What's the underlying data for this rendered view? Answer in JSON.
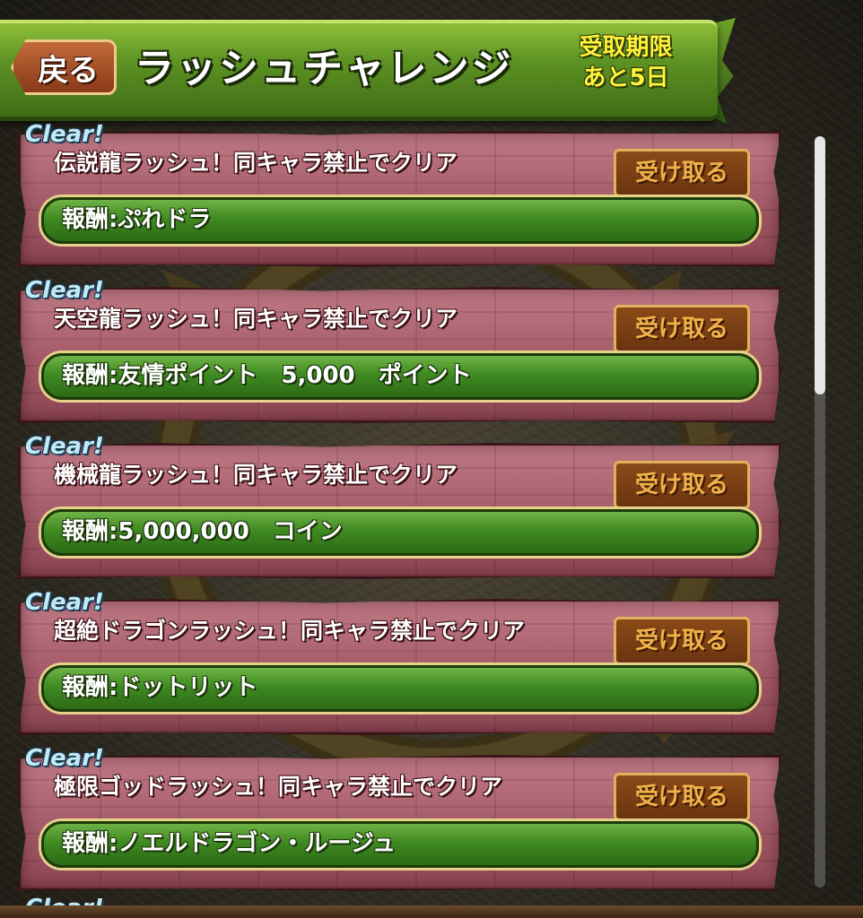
{
  "header": {
    "back_label": "戻る",
    "title": "ラッシュチャレンジ",
    "deadline_line1": "受取期限",
    "deadline_line2": "あと5日"
  },
  "clear_label": "Clear!",
  "receive_label": "受け取る",
  "missions": [
    {
      "text": "伝説龍ラッシュ！同キャラ禁止でクリア",
      "reward": "報酬:ぷれドラ"
    },
    {
      "text": "天空龍ラッシュ！同キャラ禁止でクリア",
      "reward": "報酬:友情ポイント　5,000　ポイント"
    },
    {
      "text": "機械龍ラッシュ！同キャラ禁止でクリア",
      "reward": "報酬:5,000,000　コイン"
    },
    {
      "text": "超絶ドラゴンラッシュ！同キャラ禁止でクリア",
      "reward": "報酬:ドットリット"
    },
    {
      "text": "極限ゴッドラッシュ！同キャラ禁止でクリア",
      "reward": "報酬:ノエルドラゴン・ルージュ"
    }
  ],
  "colors": {
    "header_green": "#5e9324",
    "panel_pink": "#a35a67",
    "reward_green": "#3f8a22",
    "button_brown": "#8a4a18",
    "deadline_yellow": "#fff23a",
    "clear_blue": "#bfeaf6"
  }
}
